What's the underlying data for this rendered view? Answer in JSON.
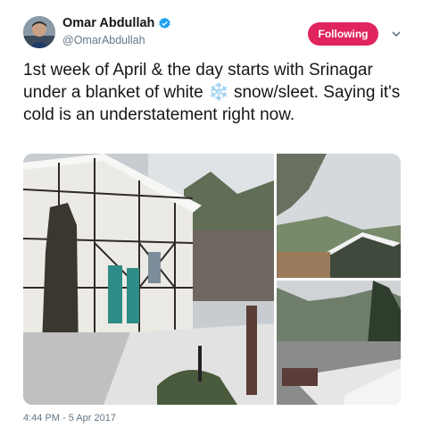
{
  "header": {
    "display_name": "Omar Abdullah",
    "handle": "@OmarAbdullah",
    "follow_label": "Following",
    "accent_color": "#e0245e",
    "verified_color": "#1da1f2",
    "icons": [
      "avatar",
      "verified-badge-icon",
      "chevron-down-icon"
    ]
  },
  "tweet": {
    "text": "1st week of April & the day starts with Srinagar under a blanket of white ❄️ snow/sleet. Saying it's cold is an understatement right now.",
    "timestamp": "4:44 PM - 5 Apr 2017"
  },
  "media": {
    "count": 3
  }
}
